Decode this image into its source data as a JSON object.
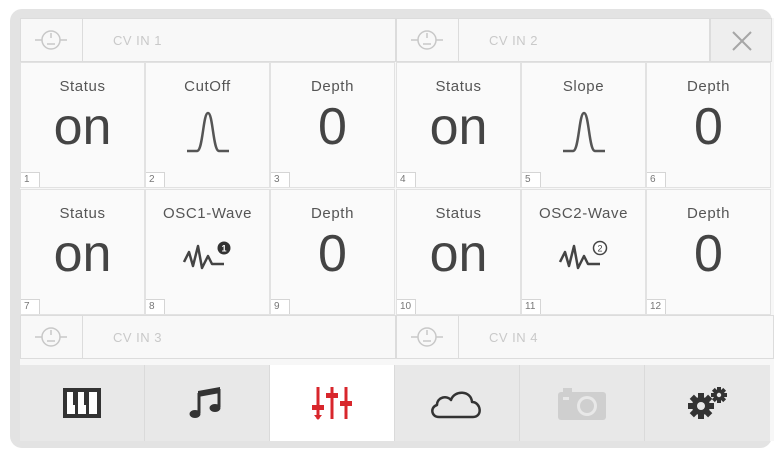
{
  "cv_inputs": [
    {
      "label": "CV IN 1"
    },
    {
      "label": "CV IN 2"
    },
    {
      "label": "CV IN 3"
    },
    {
      "label": "CV IN 4"
    }
  ],
  "cells": [
    {
      "title": "Status",
      "value": "on",
      "index": "1"
    },
    {
      "title": "CutOff",
      "value": "peak-curve",
      "index": "2"
    },
    {
      "title": "Depth",
      "value": "0",
      "index": "3"
    },
    {
      "title": "Status",
      "value": "on",
      "index": "4"
    },
    {
      "title": "Slope",
      "value": "peak-curve",
      "index": "5"
    },
    {
      "title": "Depth",
      "value": "0",
      "index": "6"
    },
    {
      "title": "Status",
      "value": "on",
      "index": "7"
    },
    {
      "title": "OSC1-Wave",
      "value": "wave-1",
      "index": "8",
      "badge": "1"
    },
    {
      "title": "Depth",
      "value": "0",
      "index": "9"
    },
    {
      "title": "Status",
      "value": "on",
      "index": "10"
    },
    {
      "title": "OSC2-Wave",
      "value": "wave-2",
      "index": "11",
      "badge": "2"
    },
    {
      "title": "Depth",
      "value": "0",
      "index": "12"
    }
  ],
  "tabs": [
    {
      "icon": "piano-keys-icon",
      "active": false
    },
    {
      "icon": "music-note-icon",
      "active": false
    },
    {
      "icon": "mixer-sliders-icon",
      "active": true
    },
    {
      "icon": "cloud-icon",
      "active": false
    },
    {
      "icon": "camera-icon",
      "active": false,
      "disabled": true
    },
    {
      "icon": "gears-icon",
      "active": false
    }
  ],
  "colors": {
    "accent": "#d8262c",
    "text": "#444444",
    "muted": "#c9c9c9",
    "tab_bg": "#e8e8e8"
  }
}
